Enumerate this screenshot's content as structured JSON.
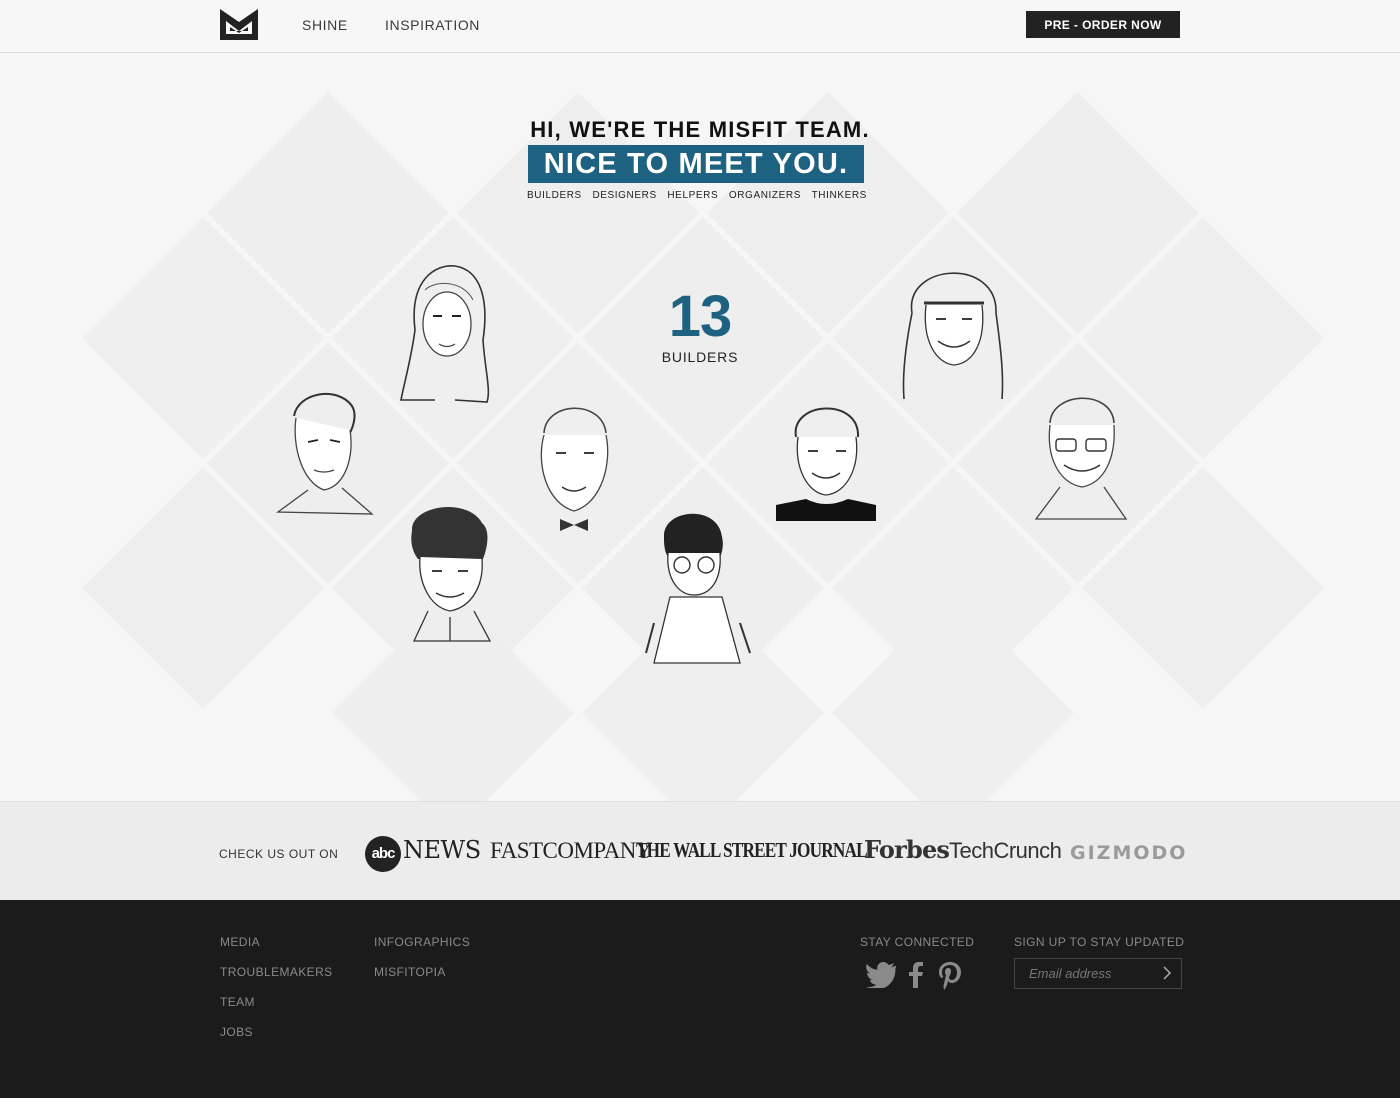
{
  "header": {
    "logo_icon": "misfit-logo-icon",
    "nav": [
      {
        "label": "SHINE"
      },
      {
        "label": "INSPIRATION"
      }
    ],
    "cta_label": "PRE - ORDER NOW"
  },
  "hero": {
    "intro": "HI, WE'RE THE MISFIT TEAM.",
    "headline": "NICE TO MEET YOU.",
    "roles": [
      "BUILDERS",
      "DESIGNERS",
      "HELPERS",
      "ORGANIZERS",
      "THINKERS"
    ],
    "count": "13",
    "count_label": "BUILDERS",
    "accent_color": "#1e6281",
    "portraits": [
      {
        "icon": "caricature-woman-long-hair-icon"
      },
      {
        "icon": "caricature-man-wavy-hair-icon"
      },
      {
        "icon": "caricature-man-bowtie-icon"
      },
      {
        "icon": "caricature-man-pompadour-icon"
      },
      {
        "icon": "caricature-boy-glasses-icon"
      },
      {
        "icon": "caricature-woman-short-hair-icon"
      },
      {
        "icon": "caricature-woman-bangs-icon"
      },
      {
        "icon": "caricature-man-glasses-icon"
      }
    ]
  },
  "press": {
    "label": "CHECK US OUT ON",
    "abc_mark": "abc",
    "abc_news": "NEWS",
    "fastcompany": "FASTCOMPANY",
    "wsj": "THE WALL STREET JOURNAL.",
    "forbes": "Forbes",
    "techcrunch": "TechCrunch",
    "gizmodo": "GIZMODO"
  },
  "footer": {
    "col1": [
      "MEDIA",
      "TROUBLEMAKERS",
      "TEAM",
      "JOBS"
    ],
    "col2": [
      "INFOGRAPHICS",
      "MISFITOPIA"
    ],
    "stay_connected": "STAY CONNECTED",
    "social": [
      {
        "icon": "twitter-icon"
      },
      {
        "icon": "facebook-icon"
      },
      {
        "icon": "pinterest-icon"
      }
    ],
    "signup_label": "SIGN UP TO STAY UPDATED",
    "email_placeholder": "Email address"
  }
}
